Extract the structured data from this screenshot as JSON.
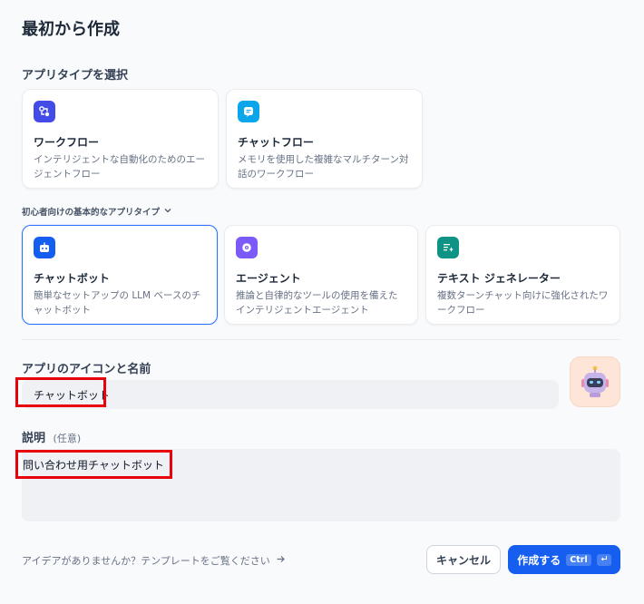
{
  "title": "最初から作成",
  "app_type": {
    "label": "アプリタイプを選択",
    "cards": [
      {
        "name": "ワークフロー",
        "desc": "インテリジェントな自動化のためのエージェントフロー",
        "icon": "workflow-icon",
        "color": "#444ce7"
      },
      {
        "name": "チャットフロー",
        "desc": "メモリを使用した複雑なマルチターン対話のワークフロー",
        "icon": "chatflow-icon",
        "color": "#0ba5ec"
      }
    ]
  },
  "beginner": {
    "label": "初心者向けの基本的なアプリタイプ",
    "cards": [
      {
        "name": "チャットボット",
        "desc": "簡単なセットアップの LLM ベースのチャットボット",
        "icon": "chatbot-icon",
        "color": "#155eef"
      },
      {
        "name": "エージェント",
        "desc": "推論と自律的なツールの使用を備えたインテリジェントエージェント",
        "icon": "agent-icon",
        "color": "#7a5af8"
      },
      {
        "name": "テキスト ジェネレーター",
        "desc": "複数ターンチャット向けに強化されたワークフロー",
        "icon": "text-generator-icon",
        "color": "#0e9384"
      }
    ]
  },
  "app_name": {
    "label": "アプリのアイコンと名前",
    "value": "チャットボット"
  },
  "description": {
    "label": "説明",
    "optional": "(任意)",
    "value": "問い合わせ用チャットボット"
  },
  "footer": {
    "link": "アイデアがありませんか？テンプレートをご覧ください",
    "cancel": "キャンセル",
    "create": "作成する",
    "shortcut": "Ctrl"
  },
  "colors": {
    "accent": "#155eef",
    "highlight": "#e8000b"
  }
}
